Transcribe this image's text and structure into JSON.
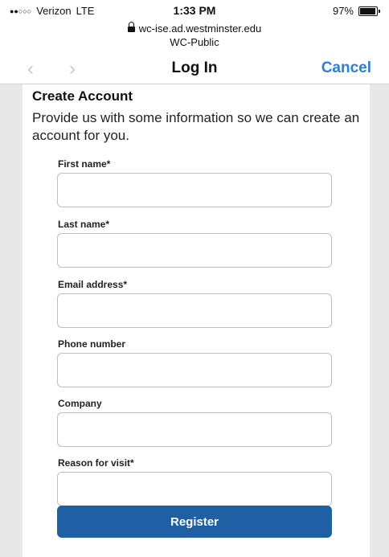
{
  "status_bar": {
    "signal": "●●○○○",
    "carrier": "Verizon",
    "network": "LTE",
    "time": "1:33 PM",
    "battery": "97%",
    "battery_icon": "battery-icon"
  },
  "browser": {
    "url": "wc-ise.ad.westminster.edu",
    "subtitle": "WC-Public",
    "back_icon": "chevron-left-icon",
    "forward_icon": "chevron-right-icon",
    "lock_icon": "lock-icon"
  },
  "nav": {
    "title": "Log In",
    "cancel_label": "Cancel",
    "accent_color": "#2d7fd1"
  },
  "form": {
    "heading": "Create Account",
    "intro": "Provide us with some information so we can create an account for you.",
    "fields": [
      {
        "label": "First name*",
        "value": ""
      },
      {
        "label": "Last name*",
        "value": ""
      },
      {
        "label": "Email address*",
        "value": ""
      },
      {
        "label": "Phone number",
        "value": ""
      },
      {
        "label": "Company",
        "value": ""
      },
      {
        "label": "Reason for visit*",
        "value": ""
      }
    ],
    "register_label": "Register",
    "register_color": "#1f5fa3"
  }
}
